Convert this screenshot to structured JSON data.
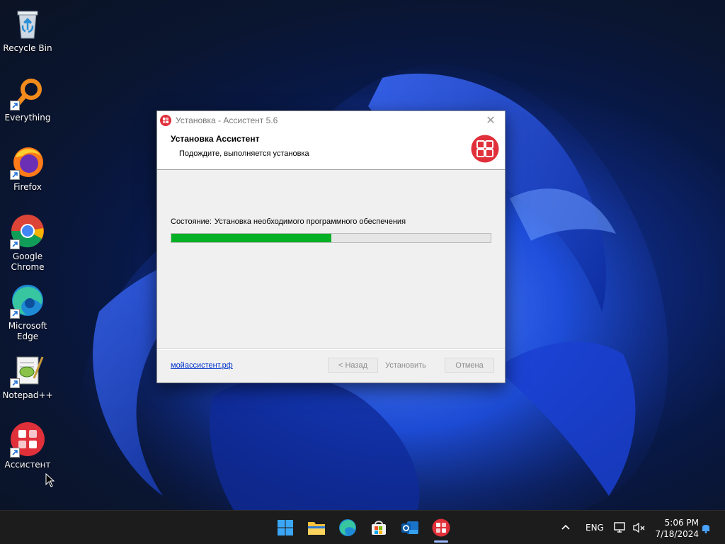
{
  "desktop": {
    "icons": [
      {
        "label": "Recycle Bin",
        "icon": "recycle-bin-icon"
      },
      {
        "label": "Everything",
        "icon": "everything-search-icon"
      },
      {
        "label": "Firefox",
        "icon": "firefox-icon"
      },
      {
        "label": "Google Chrome",
        "icon": "chrome-icon"
      },
      {
        "label": "Microsoft Edge",
        "icon": "edge-icon"
      },
      {
        "label": "Notepad++",
        "icon": "notepadpp-icon"
      },
      {
        "label": "Ассистент",
        "icon": "assistant-icon"
      }
    ]
  },
  "window": {
    "title": "Установка - Ассистент 5.6",
    "close_glyph": "✕",
    "header_title": "Установка Ассистент",
    "header_subtitle": "Подождите, выполняется установка",
    "status_label": "Состояние:",
    "status_text": "Установка необходимого программного обеспечения",
    "progress_fraction": 0.5,
    "link": "мойассистент.рф",
    "buttons": {
      "back": "< Назад",
      "install": "Установить",
      "cancel": "Отмена"
    }
  },
  "taskbar": {
    "apps": [
      "start-icon",
      "file-explorer-icon",
      "edge-icon",
      "store-icon",
      "outlook-icon",
      "assistant-icon"
    ],
    "tray": {
      "chevron": "^",
      "language": "ENG",
      "time": "5:06 PM",
      "date": "7/18/2024"
    }
  },
  "colors": {
    "accent_red": "#e0303a",
    "progress_green": "#06b025",
    "link_blue": "#0033cc"
  }
}
